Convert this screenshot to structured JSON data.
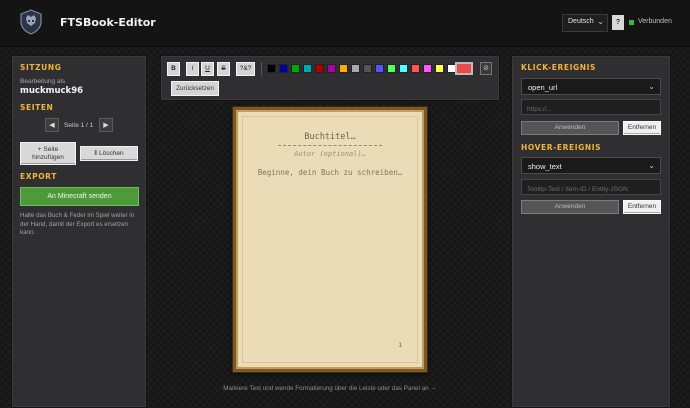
{
  "header": {
    "app_title": "FTSBook-Editor",
    "language": "Deutsch",
    "help_label": "?",
    "status_text": "Verbunden",
    "status_color": "#42b241"
  },
  "session": {
    "title": "SITZUNG",
    "editing_as_label": "Bearbeitung als",
    "username": "muckmuck96"
  },
  "pages": {
    "title": "SEITEN",
    "prev_icon": "triangle-left-icon",
    "next_icon": "triangle-right-icon",
    "indicator": "Seite 1 / 1",
    "add_label_line1": "+ Seite",
    "add_label_line2": "hinzufügen",
    "delete_label": "Löschen",
    "delete_icon": "trash-icon"
  },
  "export": {
    "title": "EXPORT",
    "send_label": "An Minecraft senden",
    "help_text": "Halte das Buch & Feder im Spiel weiter in der Hand, damit der Export es ersetzen kann."
  },
  "toolbar": {
    "format_buttons": [
      "B",
      "I",
      "U",
      "S",
      "?&?"
    ],
    "colors": [
      "#000000",
      "#0000aa",
      "#00aa00",
      "#00aaaa",
      "#aa0000",
      "#aa00aa",
      "#ffaa00",
      "#aaaaaa",
      "#555555",
      "#5555ff",
      "#55ff55",
      "#55ffff",
      "#ff5555",
      "#ff55ff",
      "#ffff55",
      "#ffffff"
    ],
    "current_color": "#e94b4b",
    "clear_icon": "no-entry-icon",
    "reset_label": "Zurücksetzen"
  },
  "book": {
    "title_placeholder": "Buchtitel…",
    "author_placeholder": "Autor (optional)…",
    "body_placeholder": "Beginne, dein Buch zu schreiben…",
    "page_number": "1"
  },
  "footer_hint": "Markiere Text und wende Formatierung über die Leiste oder das Panel an →",
  "click_event": {
    "title": "KLICK-EREIGNIS",
    "action": "open_url",
    "value_placeholder": "https://...",
    "apply_label": "Anwenden",
    "remove_label": "Entfernen"
  },
  "hover_event": {
    "title": "HOVER-EREIGNIS",
    "action": "show_text",
    "value_placeholder": "Tooltip-Text / Item-ID / Entity-JSON",
    "apply_label": "Anwenden",
    "remove_label": "Entfernen"
  },
  "theme": {
    "accent": "#f2b53a",
    "send_button": "#4e9a3a"
  }
}
